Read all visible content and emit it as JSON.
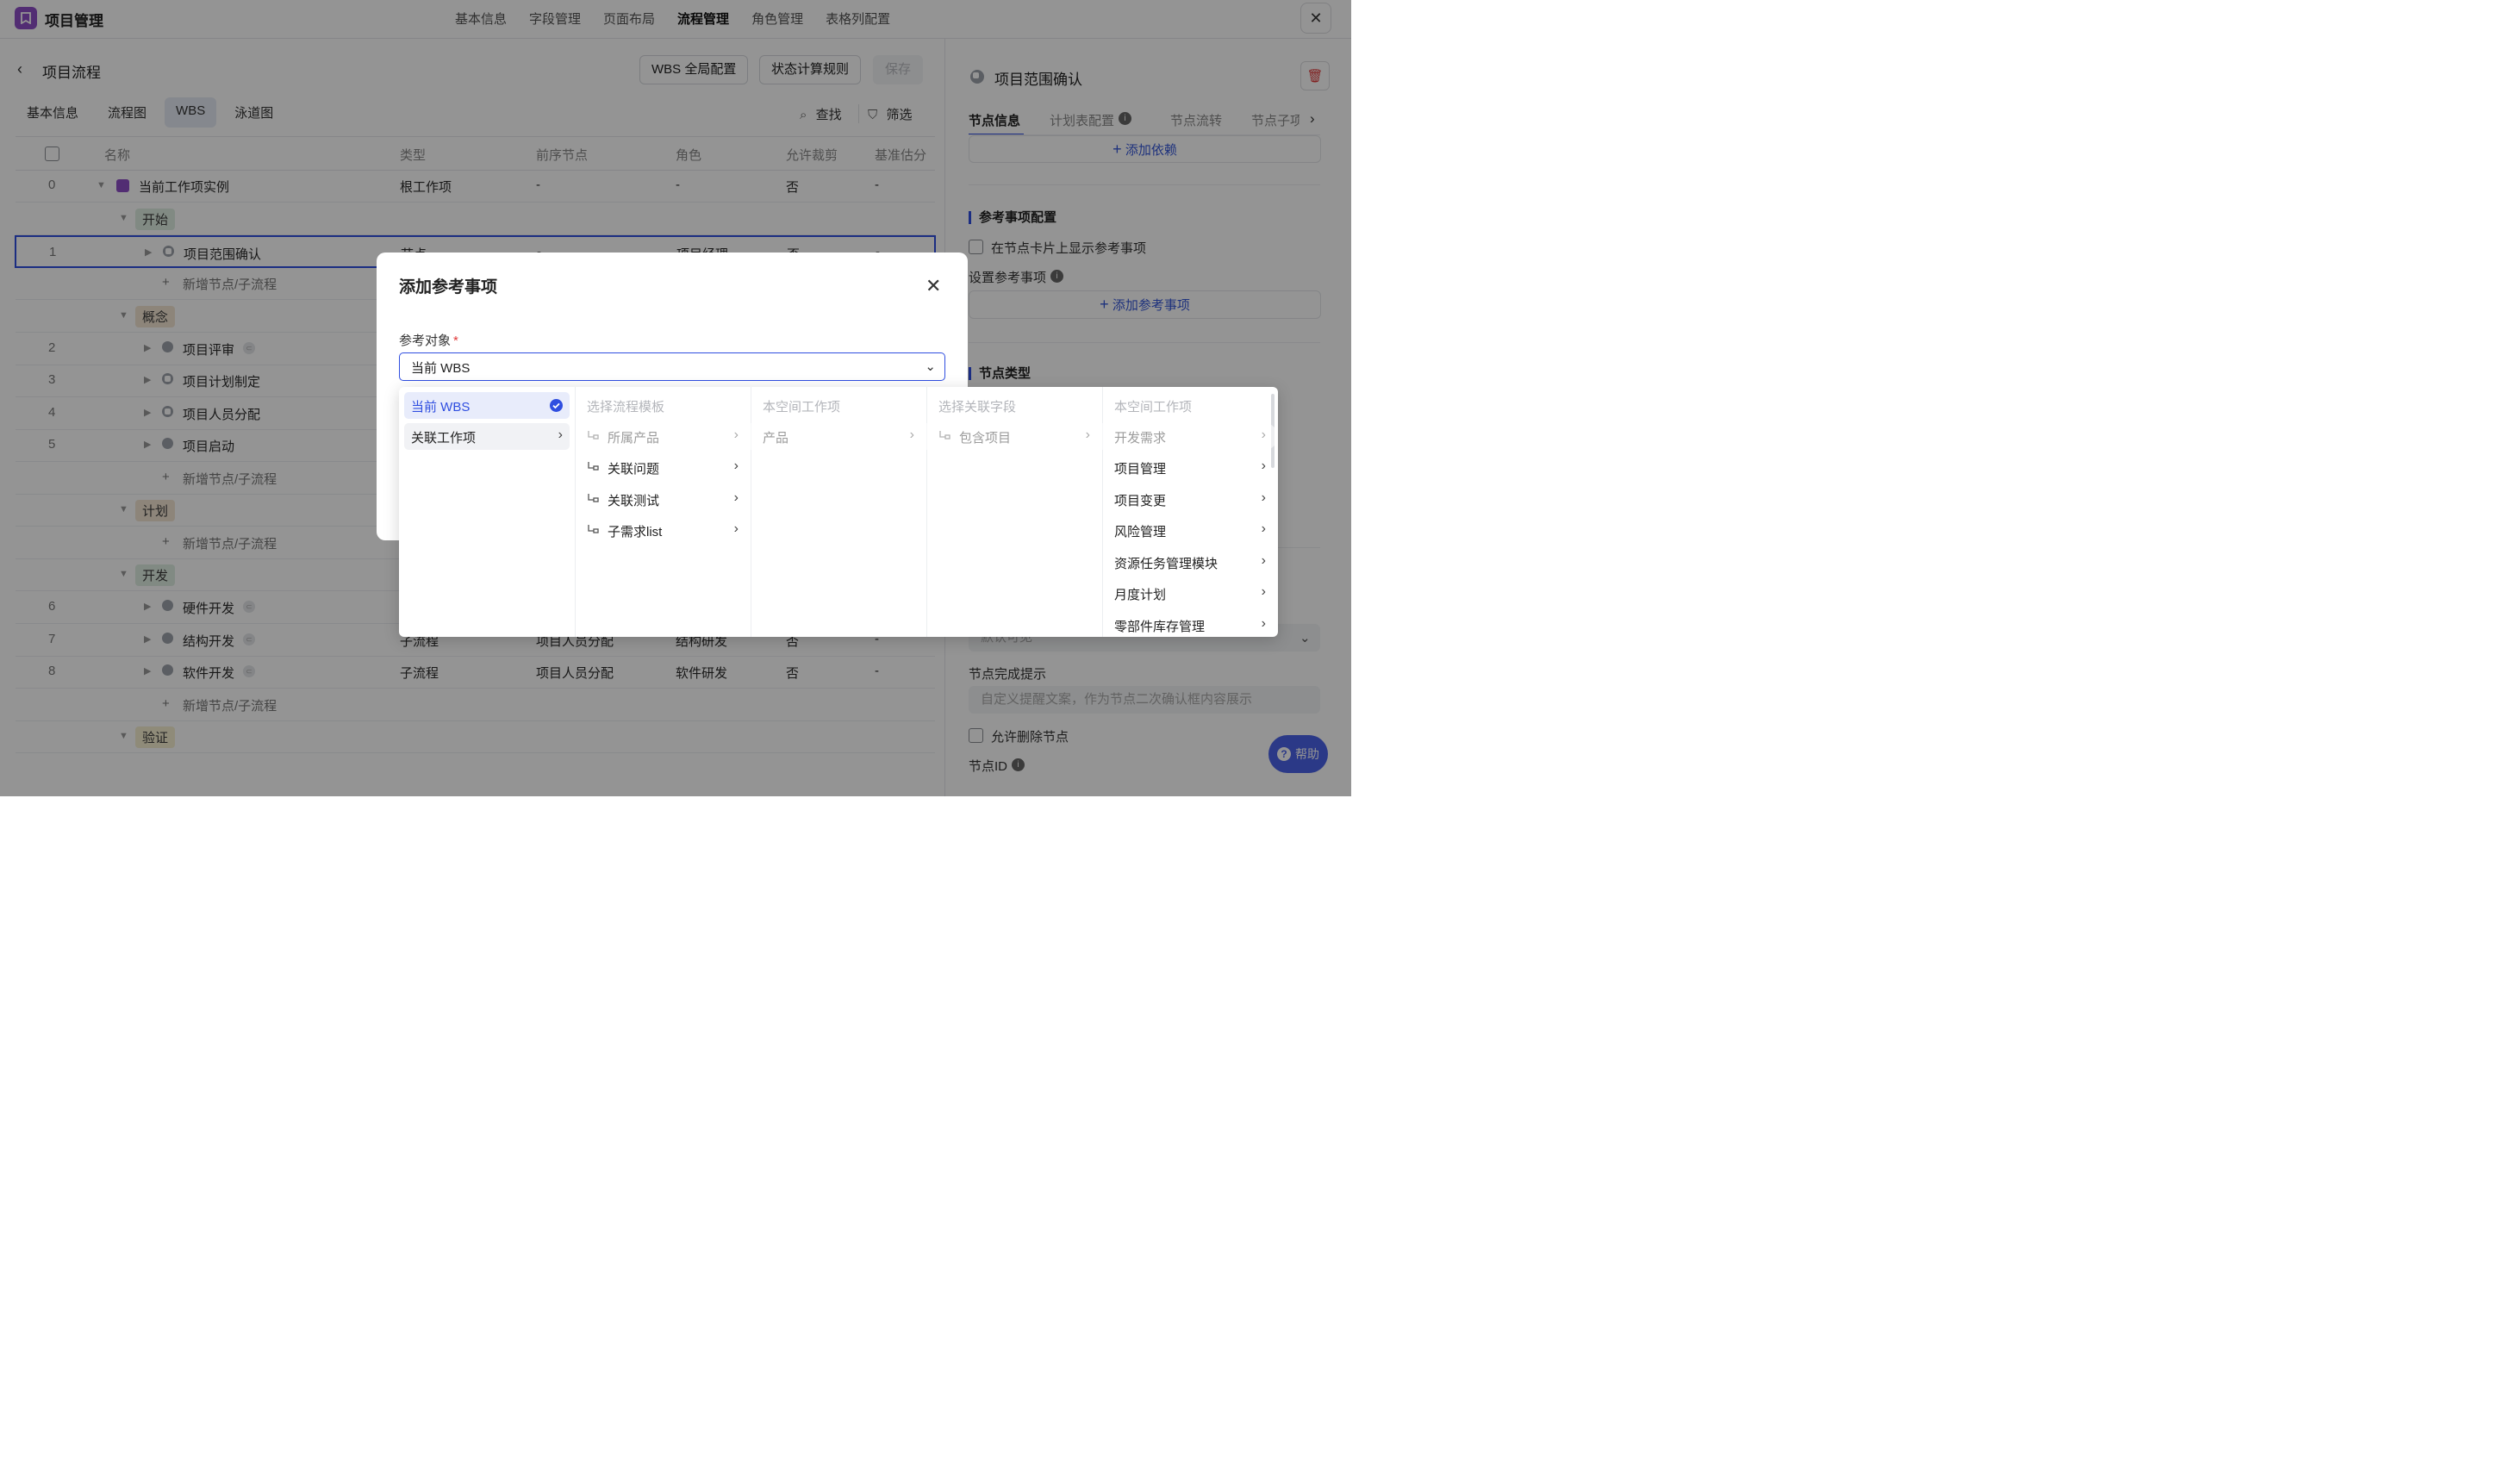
{
  "app": {
    "title": "项目管理",
    "nav": [
      "基本信息",
      "字段管理",
      "页面布局",
      "流程管理",
      "角色管理",
      "表格列配置"
    ],
    "nav_active": "流程管理"
  },
  "page": {
    "title": "项目流程",
    "buttons": {
      "wbs_global": "WBS 全局配置",
      "status_rule": "状态计算规则",
      "save": "保存"
    },
    "tabs": [
      "基本信息",
      "流程图",
      "WBS",
      "泳道图"
    ],
    "active_tab": "WBS",
    "tools": {
      "find": "查找",
      "filter": "筛选"
    }
  },
  "table": {
    "columns": [
      "名称",
      "类型",
      "前序节点",
      "角色",
      "允许裁剪",
      "基准估分"
    ],
    "root": {
      "num": "0",
      "name": "当前工作项实例",
      "type": "根工作项",
      "prev": "-",
      "role": "-",
      "cut": "否",
      "est": "-"
    },
    "phases": [
      {
        "name": "开始",
        "color": "#dfeee2"
      },
      {
        "name": "概念",
        "color": "#f3e6d3"
      },
      {
        "name": "计划",
        "color": "#f3e6d3"
      },
      {
        "name": "开发",
        "color": "#dfeee2"
      },
      {
        "name": "验证",
        "color": "#f7efd0"
      }
    ],
    "rows": [
      {
        "num": "1",
        "name": "项目范围确认",
        "type": "节点",
        "prev": "-",
        "role": "项目经理",
        "cut": "否",
        "est": "-"
      },
      {
        "num": "2",
        "name": "项目评审"
      },
      {
        "num": "3",
        "name": "项目计划制定"
      },
      {
        "num": "4",
        "name": "项目人员分配"
      },
      {
        "num": "5",
        "name": "项目启动"
      },
      {
        "num": "6",
        "name": "硬件开发"
      },
      {
        "num": "7",
        "name": "结构开发",
        "type": "子流程",
        "prev": "项目人员分配",
        "role": "结构研发",
        "cut": "否",
        "est": "-"
      },
      {
        "num": "8",
        "name": "软件开发",
        "type": "子流程",
        "prev": "项目人员分配",
        "role": "软件研发",
        "cut": "否",
        "est": "-"
      }
    ],
    "add_label": "新增节点/子流程"
  },
  "right_panel": {
    "title": "项目范围确认",
    "tabs": [
      "节点信息",
      "计划表配置",
      "节点流转",
      "节点子项"
    ],
    "add_dependency": "添加依赖",
    "ref_section": "参考事项配置",
    "show_ref_label": "在节点卡片上显示参考事项",
    "set_ref_label": "设置参考事项",
    "add_ref": "添加参考事项",
    "node_type_section": "节点类型",
    "visibility_value": "默认可见",
    "completion_label": "节点完成提示",
    "completion_placeholder": "自定义提醒文案，作为节点二次确认框内容展示",
    "allow_delete_label": "允许删除节点",
    "node_id_label": "节点ID",
    "help": "帮助"
  },
  "modal": {
    "title": "添加参考事项",
    "field_label": "参考对象",
    "select_value": "当前 WBS",
    "cascader": {
      "col1": [
        {
          "label": "当前 WBS",
          "selected": true
        },
        {
          "label": "关联工作项",
          "has_children": true
        }
      ],
      "col2_header": "选择流程模板",
      "col2": [
        "所属产品",
        "关联问题",
        "关联测试",
        "子需求list"
      ],
      "col3_header": "本空间工作项",
      "col3": [
        "产品"
      ],
      "col4_header": "选择关联字段",
      "col4": [
        "包含项目"
      ],
      "col5_header": "本空间工作项",
      "col5": [
        "开发需求",
        "项目管理",
        "项目变更",
        "风险管理",
        "资源任务管理模块",
        "月度计划",
        "零部件库存管理"
      ]
    }
  },
  "colors": {
    "accent": "#2f4ee0",
    "brand": "#8e4ec6",
    "danger": "#e03a3a"
  },
  "icons": [
    "app-logo-icon",
    "back-arrow-icon",
    "search-icon",
    "filter-icon",
    "trash-icon",
    "info-icon",
    "plus-icon",
    "close-icon",
    "chevron-down-icon",
    "chevron-right-icon",
    "check-circle-icon",
    "relation-icon",
    "help-icon"
  ]
}
